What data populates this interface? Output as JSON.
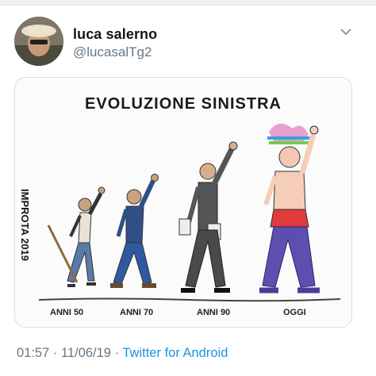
{
  "author": {
    "name": "luca salerno",
    "handle": "@lucasalTg2"
  },
  "menu": {
    "icon": "chevron-down-icon"
  },
  "media": {
    "title": "EVOLUZIONE SINISTRA",
    "signature": "IMPROTA 2019",
    "eras": [
      "ANNI 50",
      "ANNI 70",
      "ANNI 90",
      "OGGI"
    ]
  },
  "meta": {
    "time": "01:57",
    "separator": "·",
    "date": "11/06/19",
    "source": "Twitter for Android"
  },
  "colors": {
    "link": "#1b95e0",
    "muted": "#657786"
  }
}
